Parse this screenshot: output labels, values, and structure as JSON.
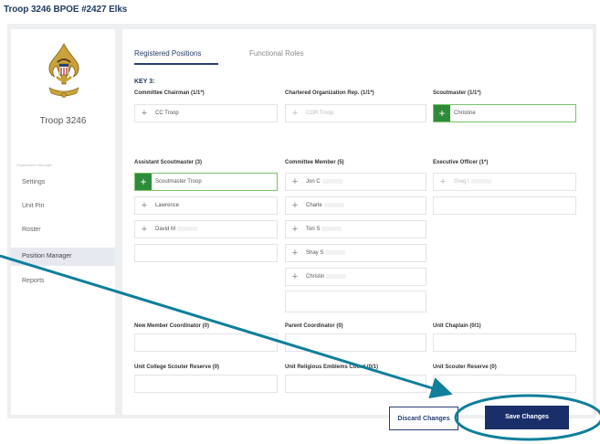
{
  "page_title": "Troop 3246 BPOE #2427 Elks",
  "sidebar": {
    "troop_name": "Troop 3246",
    "section_heading": "Organization Manager",
    "items": [
      {
        "label": "Settings"
      },
      {
        "label": "Unit Pin"
      },
      {
        "label": "Roster"
      },
      {
        "label": "Position Manager"
      },
      {
        "label": "Reports"
      }
    ]
  },
  "tabs": [
    {
      "label": "Registered Positions",
      "active": true
    },
    {
      "label": "Functional Roles",
      "active": false
    }
  ],
  "key_label": "KEY 3:",
  "positions": {
    "committee_chairman": {
      "label": "Committee Chairman (1/1*)",
      "slots": [
        "CC Troop"
      ]
    },
    "chartered_org_rep": {
      "label": "Chartered Organization Rep. (1/1*)",
      "slots": [
        "COR Troop"
      ]
    },
    "scoutmaster": {
      "label": "Scoutmaster (1/1*)",
      "slots": [
        "Christine"
      ]
    },
    "assistant_scoutmaster": {
      "label": "Assistant Scoutmaster (3)",
      "slots": [
        "Scoutmaster Troop",
        "Lawrence",
        "David M"
      ]
    },
    "committee_member": {
      "label": "Committee Member (5)",
      "slots": [
        "Jon C",
        "Charle",
        "Tori S",
        "Shay S",
        "Christin"
      ]
    },
    "executive_officer": {
      "label": "Executive Officer (1*)",
      "slots": [
        "Greg I"
      ]
    },
    "new_member_coordinator": {
      "label": "New Member Coordinator (0)"
    },
    "parent_coordinator": {
      "label": "Parent Coordinator (0)"
    },
    "unit_chaplain": {
      "label": "Unit Chaplain (0/1)"
    },
    "unit_college_scouter_reserve": {
      "label": "Unit College Scouter Reserve (0)"
    },
    "unit_religious_emblems_coord": {
      "label": "Unit Religious Emblems Coord (0/1)"
    },
    "unit_scouter_reserve": {
      "label": "Unit Scouter Reserve (0)"
    }
  },
  "add_icon": "+",
  "buttons": {
    "discard": "Discard Changes",
    "save": "Save Changes"
  },
  "colors": {
    "accent_navy": "#1a2f6a",
    "selected_green": "#2e8b3a",
    "annotation_teal": "#0f7f9a"
  }
}
